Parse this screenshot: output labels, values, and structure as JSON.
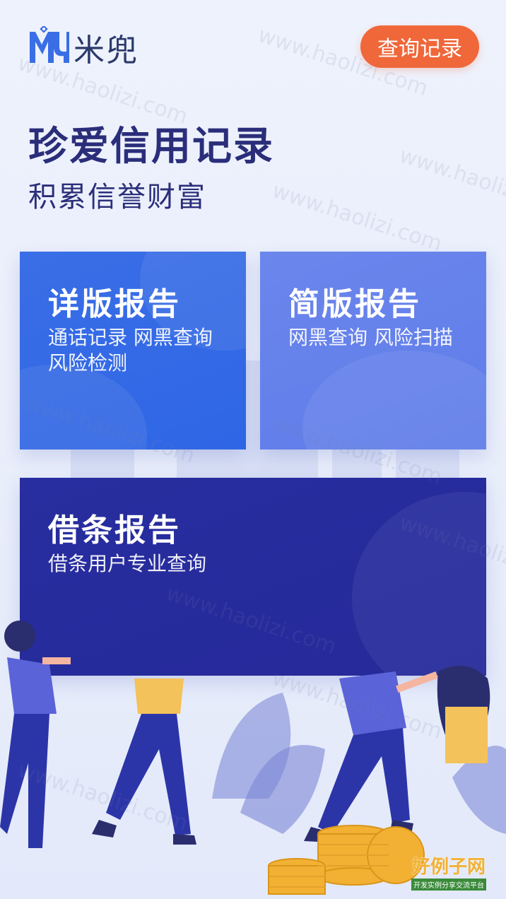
{
  "header": {
    "logo_text": "米兜",
    "history_button": "查询记录"
  },
  "hero": {
    "title": "珍爱信用记录",
    "subtitle": "积累信誉财富"
  },
  "cards": {
    "detail": {
      "title": "详版报告",
      "desc": "通话记录 网黑查询 风险检测"
    },
    "simple": {
      "title": "简版报告",
      "desc": "网黑查询 风险扫描"
    },
    "iou": {
      "title": "借条报告",
      "desc": "借条用户专业查询"
    }
  },
  "watermark": "www.haolizi.com",
  "badge": {
    "title": "好例子网",
    "subtitle": "开发实例分享交流平台"
  },
  "colors": {
    "accent": "#f0673a",
    "primary_text": "#2a2e7a",
    "card_detail": "#3168e6",
    "card_simple": "#6680eb",
    "card_iou": "#26299c"
  },
  "icons": [
    "logo-icon",
    "people-celebrating-illustration",
    "gold-coins-illustration"
  ]
}
